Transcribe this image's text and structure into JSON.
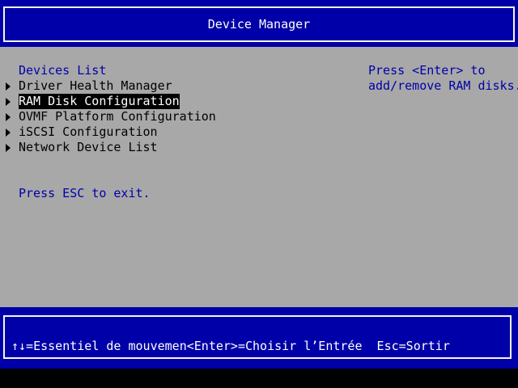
{
  "header": {
    "title": "Device Manager"
  },
  "main": {
    "section_title": "Devices List",
    "items": [
      {
        "label": "Driver Health Manager",
        "selected": false
      },
      {
        "label": "RAM Disk Configuration",
        "selected": true
      },
      {
        "label": "OVMF Platform Configuration",
        "selected": false
      },
      {
        "label": "iSCSI Configuration",
        "selected": false
      },
      {
        "label": "Network Device List",
        "selected": false
      }
    ],
    "exit_hint": "Press ESC to exit.",
    "help_lines": [
      "Press <Enter> to",
      "add/remove RAM disks."
    ]
  },
  "footer": {
    "hotkeys": "↑↓=Essentiel de mouvemen<Enter>=Choisir l’Entrée  Esc=Sortir"
  },
  "colors": {
    "header_bg": "#0000a8",
    "panel_bg": "#a8a8a8",
    "accent_text": "#0000a8",
    "selection_bg": "#000000",
    "selection_fg": "#ffffff"
  }
}
